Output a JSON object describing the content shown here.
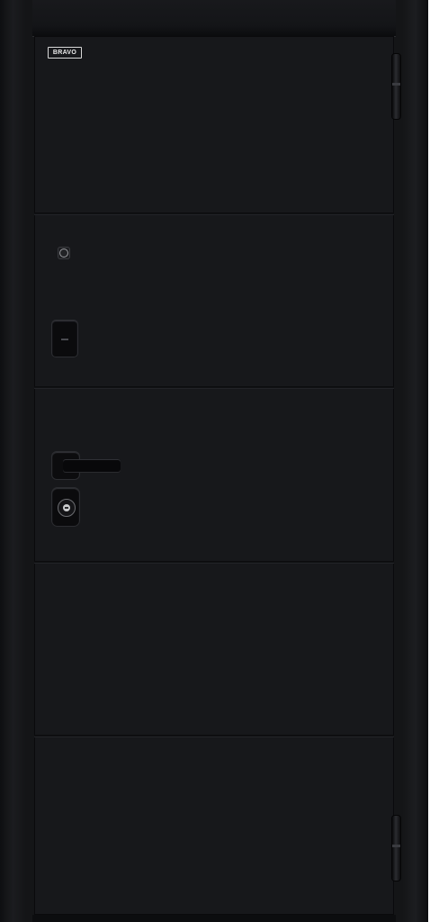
{
  "product": {
    "logo_text": "BRAVO"
  },
  "colors": {
    "door_finish": "#17181b",
    "frame": "#141517",
    "logo": "#eaeaea"
  },
  "icons": [
    "peephole-icon",
    "upper-lock-icon",
    "door-handle-icon",
    "lower-lock-cylinder-icon",
    "hinge-icon"
  ]
}
